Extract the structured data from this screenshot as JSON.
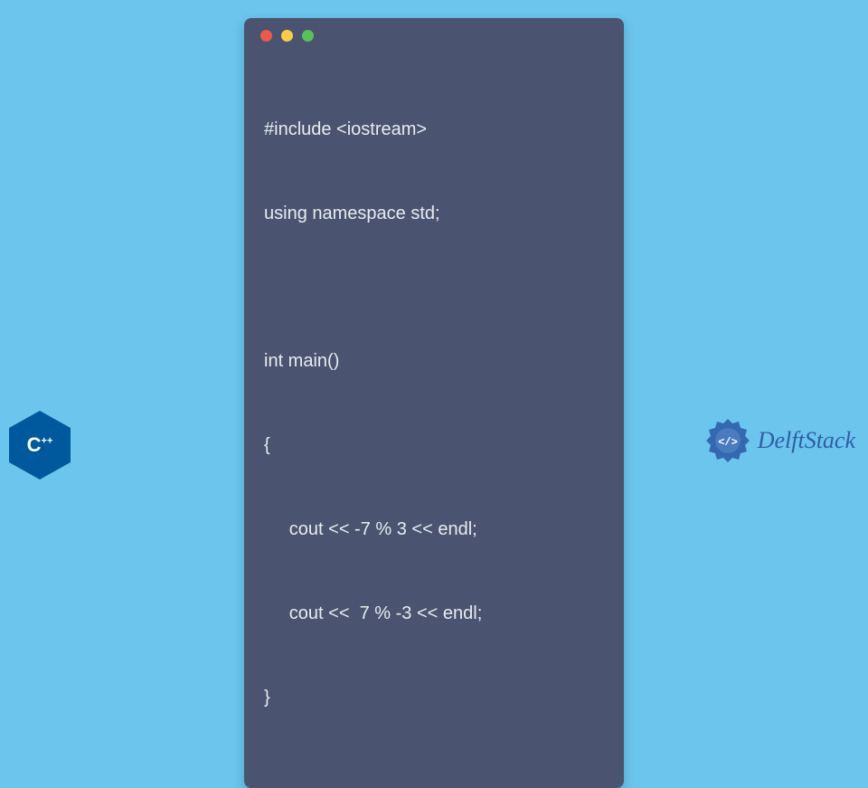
{
  "code": {
    "line1": "#include <iostream>",
    "line2": "using namespace std;",
    "line3": "int main()",
    "line4": "{",
    "line5": "     cout << -7 % 3 << endl;",
    "line6": "     cout <<  7 % -3 << endl;",
    "line7": "}"
  },
  "cpp_badge": {
    "text": "C",
    "plus": "++"
  },
  "brand": {
    "name": "DelftStack"
  },
  "colors": {
    "background": "#6bc5ed",
    "window": "#4a5470",
    "code_text": "#e8ebf0",
    "brand_blue": "#2e5ea8",
    "cpp_blue": "#00599c"
  }
}
